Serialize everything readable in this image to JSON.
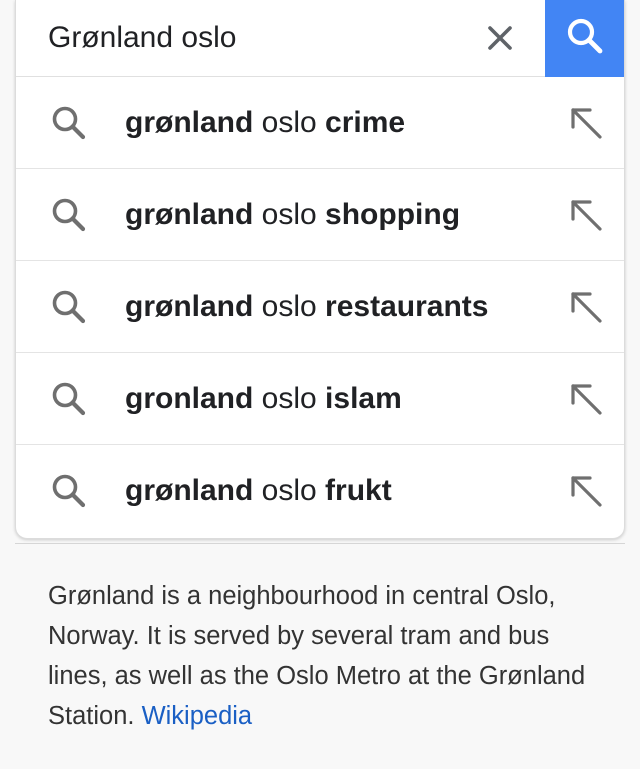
{
  "search": {
    "query": "Grønland oslo",
    "clear_icon": "close-icon",
    "submit_icon": "search-icon",
    "accent_color": "#4285f4"
  },
  "suggestions": [
    {
      "bold_prefix": "grønland",
      "middle": " oslo ",
      "bold_suffix": "crime"
    },
    {
      "bold_prefix": "grønland",
      "middle": " oslo ",
      "bold_suffix": "shopping"
    },
    {
      "bold_prefix": "grønland",
      "middle": " oslo ",
      "bold_suffix": "restaurants"
    },
    {
      "bold_prefix": "gronland",
      "middle": " oslo ",
      "bold_suffix": "islam"
    },
    {
      "bold_prefix": "grønland",
      "middle": " oslo ",
      "bold_suffix": "frukt"
    }
  ],
  "snippet": {
    "text": "Grønland is a neighbourhood in central Oslo, Norway. It is served by several tram and bus lines, as well as the Oslo Metro at the Grønland Station. ",
    "source_link": "Wikipedia",
    "link_color": "#1a5fc4"
  }
}
